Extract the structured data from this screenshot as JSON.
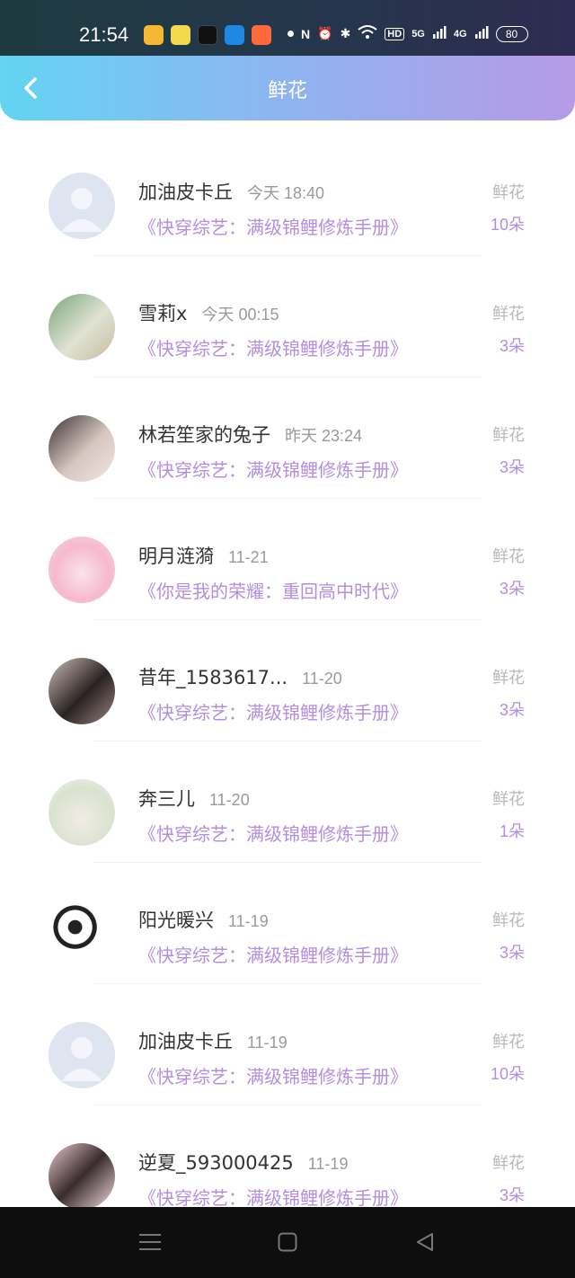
{
  "status": {
    "time": "21:54",
    "network": "5G",
    "network2": "4G",
    "battery": "80"
  },
  "header": {
    "title": "鲜花"
  },
  "gift_label": "鲜花",
  "rows": [
    {
      "name": "加油皮卡丘",
      "time": "今天 18:40",
      "book": "《快穿综艺：满级锦鲤修炼手册》",
      "count": "10朵",
      "avatar": "default-avatar-icon"
    },
    {
      "name": "雪莉x",
      "time": "今天 00:15",
      "book": "《快穿综艺：满级锦鲤修炼手册》",
      "count": "3朵",
      "avatar": "girl-photo-avatar"
    },
    {
      "name": "林若笙家的兔子",
      "time": "昨天 23:24",
      "book": "《快穿综艺：满级锦鲤修炼手册》",
      "count": "3朵",
      "avatar": "boy-photo-avatar"
    },
    {
      "name": "明月涟漪",
      "time": "11-21",
      "book": "《你是我的荣耀：重回高中时代》",
      "count": "3朵",
      "avatar": "anime-cat-girl-avatar"
    },
    {
      "name": "昔年_1583617...",
      "time": "11-20",
      "book": "《快穿综艺：满级锦鲤修炼手册》",
      "count": "3朵",
      "avatar": "child-photo-avatar"
    },
    {
      "name": "奔三儿",
      "time": "11-20",
      "book": "《快穿综艺：满级锦鲤修炼手册》",
      "count": "1朵",
      "avatar": "painted-lady-avatar"
    },
    {
      "name": "阳光暖兴",
      "time": "11-19",
      "book": "《快穿综艺：满级锦鲤修炼手册》",
      "count": "3朵",
      "avatar": "cow-print-avatar"
    },
    {
      "name": "加油皮卡丘",
      "time": "11-19",
      "book": "《快穿综艺：满级锦鲤修炼手册》",
      "count": "10朵",
      "avatar": "default-avatar-icon"
    },
    {
      "name": "逆夏_593000425",
      "time": "11-19",
      "book": "《快穿综艺：满级锦鲤修炼手册》",
      "count": "3朵",
      "avatar": "painted-girl-avatar"
    }
  ],
  "colors": {
    "accent": "#b48ee0",
    "header_start": "#63d4f2",
    "header_end": "#b69ae6"
  }
}
